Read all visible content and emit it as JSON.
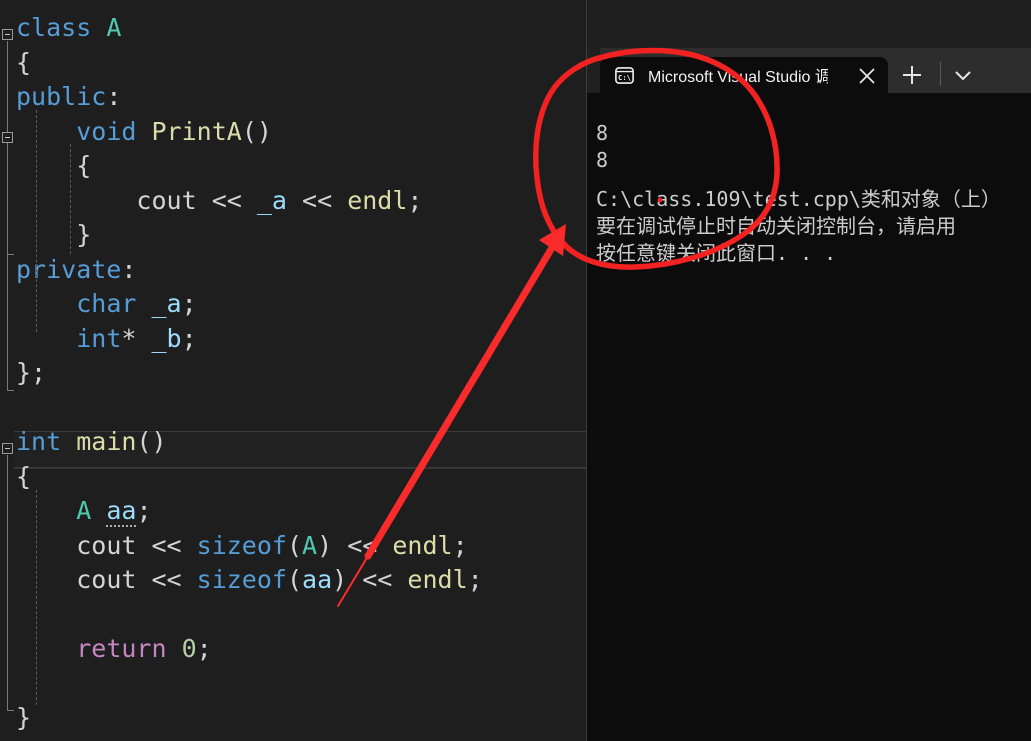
{
  "editor": {
    "name": "code-editor",
    "language": "cpp",
    "background": "#1e1e1e",
    "current_line_number": 13,
    "lines": [
      {
        "tokens": [
          {
            "t": "class",
            "c": "kw"
          },
          {
            "t": " ",
            "c": "plain"
          },
          {
            "t": "A",
            "c": "type"
          }
        ]
      },
      {
        "tokens": [
          {
            "t": "{",
            "c": "brace"
          }
        ]
      },
      {
        "tokens": [
          {
            "t": "public",
            "c": "kw"
          },
          {
            "t": ":",
            "c": "plain"
          }
        ]
      },
      {
        "tokens": [
          {
            "t": "    ",
            "c": "plain"
          },
          {
            "t": "void",
            "c": "kw"
          },
          {
            "t": " ",
            "c": "plain"
          },
          {
            "t": "PrintA",
            "c": "fn"
          },
          {
            "t": "()",
            "c": "plain"
          }
        ]
      },
      {
        "tokens": [
          {
            "t": "    {",
            "c": "brace"
          }
        ]
      },
      {
        "tokens": [
          {
            "t": "        ",
            "c": "plain"
          },
          {
            "t": "cout",
            "c": "plain"
          },
          {
            "t": " << ",
            "c": "plain"
          },
          {
            "t": "_a",
            "c": "var"
          },
          {
            "t": " << ",
            "c": "plain"
          },
          {
            "t": "endl",
            "c": "fn"
          },
          {
            "t": ";",
            "c": "plain"
          }
        ]
      },
      {
        "tokens": [
          {
            "t": "    }",
            "c": "brace"
          }
        ]
      },
      {
        "tokens": [
          {
            "t": "private",
            "c": "kw"
          },
          {
            "t": ":",
            "c": "plain"
          }
        ]
      },
      {
        "tokens": [
          {
            "t": "    ",
            "c": "plain"
          },
          {
            "t": "char",
            "c": "kw"
          },
          {
            "t": " ",
            "c": "plain"
          },
          {
            "t": "_a",
            "c": "var"
          },
          {
            "t": ";",
            "c": "plain"
          }
        ]
      },
      {
        "tokens": [
          {
            "t": "    ",
            "c": "plain"
          },
          {
            "t": "int",
            "c": "kw"
          },
          {
            "t": "*",
            "c": "plain"
          },
          {
            "t": " ",
            "c": "plain"
          },
          {
            "t": "_b",
            "c": "var"
          },
          {
            "t": ";",
            "c": "plain"
          }
        ]
      },
      {
        "tokens": [
          {
            "t": "};",
            "c": "brace"
          }
        ]
      },
      {
        "tokens": []
      },
      {
        "tokens": [
          {
            "t": "int",
            "c": "kw"
          },
          {
            "t": " ",
            "c": "plain"
          },
          {
            "t": "main",
            "c": "fn"
          },
          {
            "t": "()",
            "c": "plain"
          }
        ]
      },
      {
        "tokens": [
          {
            "t": "{",
            "c": "brace"
          }
        ]
      },
      {
        "tokens": [
          {
            "t": "    ",
            "c": "plain"
          },
          {
            "t": "A",
            "c": "type"
          },
          {
            "t": " ",
            "c": "plain"
          },
          {
            "t": "aa",
            "c": "var squiggle"
          },
          {
            "t": ";",
            "c": "plain"
          }
        ]
      },
      {
        "tokens": [
          {
            "t": "    ",
            "c": "plain"
          },
          {
            "t": "cout",
            "c": "plain"
          },
          {
            "t": " << ",
            "c": "plain"
          },
          {
            "t": "sizeof",
            "c": "blue"
          },
          {
            "t": "(",
            "c": "plain"
          },
          {
            "t": "A",
            "c": "type"
          },
          {
            "t": ")",
            "c": "plain"
          },
          {
            "t": " << ",
            "c": "plain"
          },
          {
            "t": "endl",
            "c": "fn"
          },
          {
            "t": ";",
            "c": "plain"
          }
        ]
      },
      {
        "tokens": [
          {
            "t": "    ",
            "c": "plain"
          },
          {
            "t": "cout",
            "c": "plain"
          },
          {
            "t": " << ",
            "c": "plain"
          },
          {
            "t": "sizeof",
            "c": "blue"
          },
          {
            "t": "(",
            "c": "plain"
          },
          {
            "t": "aa",
            "c": "var"
          },
          {
            "t": ")",
            "c": "plain"
          },
          {
            "t": " << ",
            "c": "plain"
          },
          {
            "t": "endl",
            "c": "fn"
          },
          {
            "t": ";",
            "c": "plain"
          }
        ]
      },
      {
        "tokens": []
      },
      {
        "tokens": [
          {
            "t": "    ",
            "c": "plain"
          },
          {
            "t": "return",
            "c": "ctrl"
          },
          {
            "t": " ",
            "c": "plain"
          },
          {
            "t": "0",
            "c": "num"
          },
          {
            "t": ";",
            "c": "plain"
          }
        ]
      },
      {
        "tokens": []
      },
      {
        "tokens": [
          {
            "t": "}",
            "c": "brace"
          }
        ]
      }
    ]
  },
  "terminal": {
    "tab": {
      "title": "Microsoft Visual Studio 调试控",
      "icon": "console-icon",
      "close_label": "✕"
    },
    "new_tab_label": "＋",
    "dropdown_label": "⌄",
    "output_lines": [
      "8",
      "8",
      "",
      "C:\\class.109\\test.cpp\\类和对象（上）",
      "要在调试停止时自动关闭控制台，请启用",
      "按任意键关闭此窗口. . ."
    ]
  },
  "annotations": {
    "circle": {
      "name": "red-circle-highlight",
      "color": "#f22222"
    },
    "arrow": {
      "name": "red-arrow",
      "color": "#fb2b2b"
    }
  },
  "colors": {
    "editor_bg": "#1e1e1e",
    "terminal_bg": "#0c0c0c",
    "tabbar_bg": "#2d2d2d",
    "keyword": "#569cd6",
    "type": "#4ec9b0",
    "function": "#dcdcaa",
    "variable": "#9cdcfe",
    "control": "#c586c0",
    "number": "#b5cea8",
    "text": "#d4d4d4",
    "annotation_red": "#f22222"
  }
}
